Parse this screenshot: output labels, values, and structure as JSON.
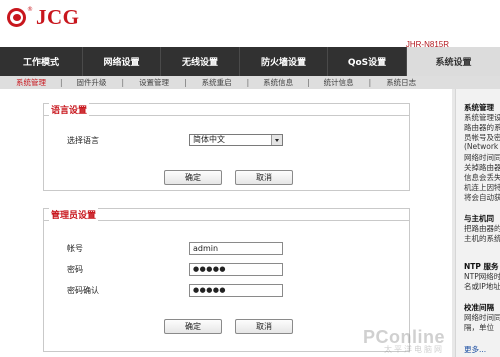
{
  "header": {
    "logo_reg": "®",
    "logo_text": "JCG",
    "model": "JHR-N815R"
  },
  "nav": {
    "tabs": [
      {
        "label": "工作模式"
      },
      {
        "label": "网络设置"
      },
      {
        "label": "无线设置"
      },
      {
        "label": "防火墙设置"
      },
      {
        "label": "QoS设置"
      },
      {
        "label": "系统设置",
        "active": true
      }
    ],
    "subtabs": [
      {
        "label": "系统管理",
        "active": true
      },
      {
        "label": "固件升级"
      },
      {
        "label": "设置管理"
      },
      {
        "label": "系统重启"
      },
      {
        "label": "系统信息"
      },
      {
        "label": "统计信息"
      },
      {
        "label": "系统日志"
      }
    ],
    "separator": "|"
  },
  "language_section": {
    "title": "语言设置",
    "select_label": "选择语言",
    "selected_language": "简体中文",
    "confirm_label": "确定",
    "cancel_label": "取消"
  },
  "admin_section": {
    "title": "管理员设置",
    "username_label": "帐号",
    "username_value": "admin",
    "password_label": "密码",
    "password_value": "●●●●●",
    "confirm_password_label": "密码确认",
    "confirm_password_value": "●●●●●",
    "confirm_label": "确定",
    "cancel_label": "取消"
  },
  "help": {
    "lines": [
      {
        "text": "系统管理",
        "bold": true
      },
      {
        "text": "系统管理设"
      },
      {
        "text": "路由器的系"
      },
      {
        "text": "员帐号及密"
      },
      {
        "text": "(Network"
      },
      {
        "text": "网络时间同"
      },
      {
        "text": "关掉路由器"
      },
      {
        "text": "信息会丢失"
      },
      {
        "text": "机连上因特"
      },
      {
        "text": "将会自动获"
      },
      {
        "text": "与主机同",
        "bold": true
      },
      {
        "text": "把路由器的"
      },
      {
        "text": "主机的系统"
      },
      {
        "text": "NTP 服务",
        "bold": true
      },
      {
        "text": "NTP网络时"
      },
      {
        "text": "名或IP地址"
      },
      {
        "text": "校准间隔",
        "bold": true
      },
      {
        "text": "网络时间同"
      },
      {
        "text": "隔，单位"
      }
    ],
    "more_link": "更多..."
  },
  "watermark": {
    "text": "PConline",
    "sub": "太平洋电脑网"
  }
}
